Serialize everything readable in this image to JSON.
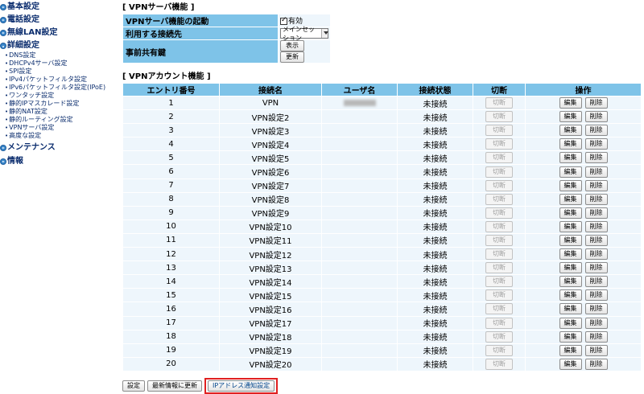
{
  "sidebar": {
    "basic": "基本設定",
    "phone": "電話設定",
    "wireless": "無線LAN設定",
    "advanced": "詳細設定",
    "advanced_items": [
      "DNS設定",
      "DHCPv4サーバ設定",
      "SPI設定",
      "IPv4パケットフィルタ設定",
      "IPv6パケットフィルタ設定(IPoE)",
      "ワンタッチ設定",
      "静的IPマスカレード設定",
      "静的NAT設定",
      "静的ルーティング設定",
      "VPNサーバ設定",
      "高度な設定"
    ],
    "maintenance": "メンテナンス",
    "info": "情報"
  },
  "vpn_server": {
    "title": "[ VPNサーバ機能 ]",
    "enable_label": "VPNサーバ機能の起動",
    "enable_value": "有効",
    "enabled": true,
    "connection_label": "利用する接続先",
    "connection_value": "メインセッション",
    "psk_label": "事前共有鍵",
    "show_button": "表示",
    "update_button": "更新"
  },
  "vpn_accounts": {
    "title": "[ VPNアカウント機能 ]",
    "columns": [
      "エントリ番号",
      "接続名",
      "ユーザ名",
      "接続状態",
      "切断",
      "操作"
    ],
    "disconnect_label": "切断",
    "edit_label": "編集",
    "delete_label": "削除",
    "rows": [
      {
        "entry": "1",
        "name": "VPN",
        "user": "",
        "user_blurred": true,
        "status": "未接続"
      },
      {
        "entry": "2",
        "name": "VPN設定2",
        "user": "",
        "status": "未接続"
      },
      {
        "entry": "3",
        "name": "VPN設定3",
        "user": "",
        "status": "未接続"
      },
      {
        "entry": "4",
        "name": "VPN設定4",
        "user": "",
        "status": "未接続"
      },
      {
        "entry": "5",
        "name": "VPN設定5",
        "user": "",
        "status": "未接続"
      },
      {
        "entry": "6",
        "name": "VPN設定6",
        "user": "",
        "status": "未接続"
      },
      {
        "entry": "7",
        "name": "VPN設定7",
        "user": "",
        "status": "未接続"
      },
      {
        "entry": "8",
        "name": "VPN設定8",
        "user": "",
        "status": "未接続"
      },
      {
        "entry": "9",
        "name": "VPN設定9",
        "user": "",
        "status": "未接続"
      },
      {
        "entry": "10",
        "name": "VPN設定10",
        "user": "",
        "status": "未接続"
      },
      {
        "entry": "11",
        "name": "VPN設定11",
        "user": "",
        "status": "未接続"
      },
      {
        "entry": "12",
        "name": "VPN設定12",
        "user": "",
        "status": "未接続"
      },
      {
        "entry": "13",
        "name": "VPN設定13",
        "user": "",
        "status": "未接続"
      },
      {
        "entry": "14",
        "name": "VPN設定14",
        "user": "",
        "status": "未接続"
      },
      {
        "entry": "15",
        "name": "VPN設定15",
        "user": "",
        "status": "未接続"
      },
      {
        "entry": "16",
        "name": "VPN設定16",
        "user": "",
        "status": "未接続"
      },
      {
        "entry": "17",
        "name": "VPN設定17",
        "user": "",
        "status": "未接続"
      },
      {
        "entry": "18",
        "name": "VPN設定18",
        "user": "",
        "status": "未接続"
      },
      {
        "entry": "19",
        "name": "VPN設定19",
        "user": "",
        "status": "未接続"
      },
      {
        "entry": "20",
        "name": "VPN設定20",
        "user": "",
        "status": "未接続"
      }
    ]
  },
  "footer": {
    "settings_button": "設定",
    "refresh_button": "最新情報に更新",
    "ip_notify_button": "IPアドレス通知設定"
  },
  "colors": {
    "header_bg": "#7ec3e8",
    "cell_bg": "#eef6fc",
    "nav_text": "#0b2d6e",
    "highlight_border": "#e02020"
  }
}
